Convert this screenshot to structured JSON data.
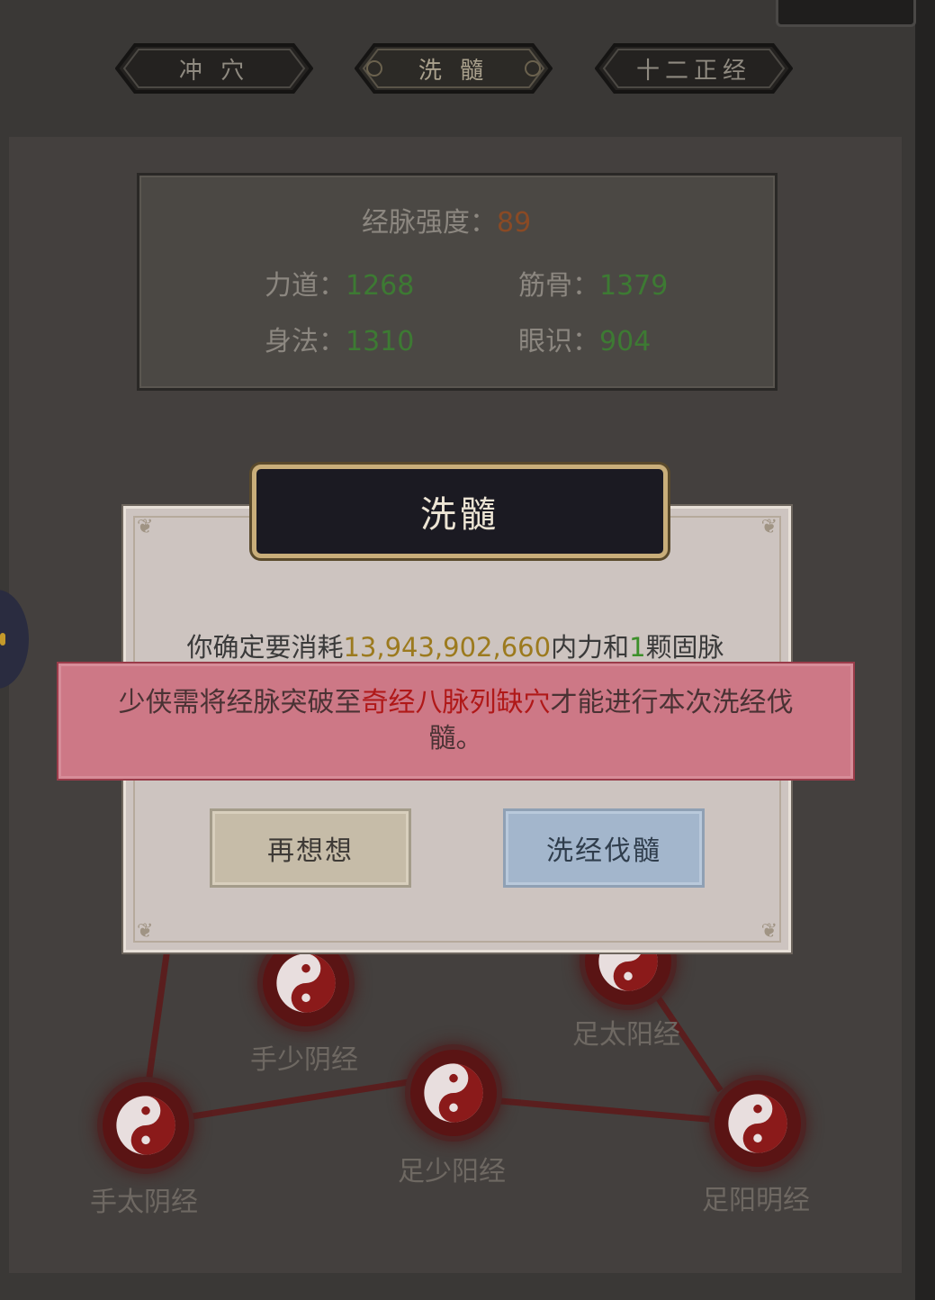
{
  "tabs": [
    {
      "label": "冲 穴",
      "active": false
    },
    {
      "label": "洗 髓",
      "active": true
    },
    {
      "label": "十二正经",
      "active": false
    }
  ],
  "stats": {
    "strength_label": "经脉强度：",
    "strength_value": "89",
    "power_label": "力道：",
    "power_value": "1268",
    "bone_label": "筋骨：",
    "bone_value": "1379",
    "agility_label": "身法：",
    "agility_value": "1310",
    "insight_label": "眼识：",
    "insight_value": "904"
  },
  "meridians": [
    {
      "label": "手少阴经"
    },
    {
      "label": "足太阳经"
    },
    {
      "label": "手太阴经"
    },
    {
      "label": "足少阳经"
    },
    {
      "label": "足阳明经"
    }
  ],
  "dialog": {
    "title": "洗髓",
    "message_prefix": "你确定要消耗",
    "message_amount": "13,943,902,660",
    "message_mid": "内力和",
    "message_count": "1",
    "message_suffix": "颗固脉",
    "cancel_label": "再想想",
    "confirm_label": "洗经伐髓"
  },
  "toast": {
    "prefix": "少侠需将经脉突破至",
    "highlight": "奇经八脉列缺穴",
    "suffix": "才能进行本次洗经伐髓。"
  },
  "colors": {
    "number_orange": "#8a4a25",
    "number_green": "#3d7a33",
    "toast_bg": "#cd7886",
    "toast_highlight": "#b01818",
    "confirm_bg": "#a3b6cc",
    "cancel_bg": "#c6bca8"
  }
}
